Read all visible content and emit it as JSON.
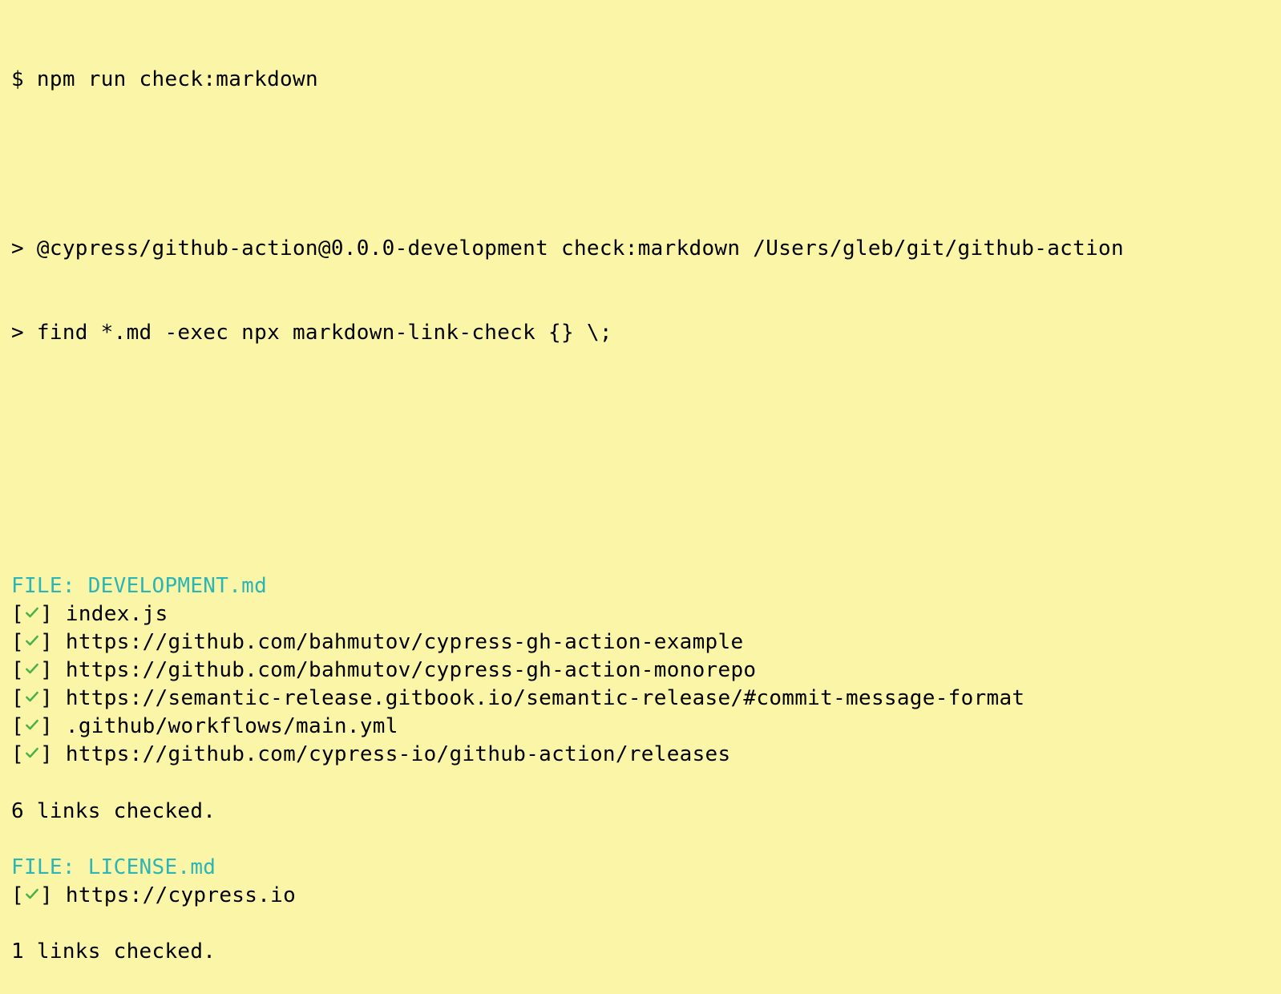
{
  "prompt": "$ ",
  "command": "npm run check:markdown",
  "script_line1": "> @cypress/github-action@0.0.0-development check:markdown /Users/gleb/git/github-action",
  "script_line2": "> find *.md -exec npx markdown-link-check {} \\;",
  "files": [
    {
      "header": "FILE: DEVELOPMENT.md",
      "links": [
        "index.js",
        "https://github.com/bahmutov/cypress-gh-action-example",
        "https://github.com/bahmutov/cypress-gh-action-monorepo",
        "https://semantic-release.gitbook.io/semantic-release/#commit-message-format",
        ".github/workflows/main.yml",
        "https://github.com/cypress-io/github-action/releases"
      ],
      "summary": "6 links checked."
    },
    {
      "header": "FILE: LICENSE.md",
      "links": [
        "https://cypress.io"
      ],
      "summary": "1 links checked."
    }
  ],
  "bracket_open": "[",
  "bracket_close": "] "
}
